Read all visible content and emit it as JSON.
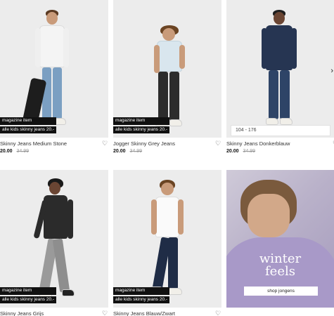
{
  "products": [
    {
      "name": "Skinny Jeans Medium Stone",
      "price": "20.00",
      "old_price": "34.99",
      "badges": [
        "magazine item",
        "alle kids skinny jeans 20.-"
      ]
    },
    {
      "name": "Jogger Skinny Grey Jeans",
      "price": "20.00",
      "old_price": "34.99",
      "badges": [
        "magazine item",
        "alle kids skinny jeans 20.-"
      ]
    },
    {
      "name": "Skinny Jeans Donkerblauw",
      "price": "20.00",
      "old_price": "34.99",
      "badges": [],
      "size_range": "104 - 176"
    },
    {
      "name": "Skinny Jeans Grijs",
      "badges": [
        "magazine item",
        "alle kids skinny jeans 20.-"
      ]
    },
    {
      "name": "Skinny Jeans Blauw/Zwart",
      "badges": [
        "magazine item",
        "alle kids skinny jeans 20.-"
      ]
    }
  ],
  "promo": {
    "line1": "winter",
    "line2": "feels",
    "button": "shop jongens"
  },
  "icons": {
    "wishlist": "heart-icon",
    "next": "chevron-right-icon"
  }
}
